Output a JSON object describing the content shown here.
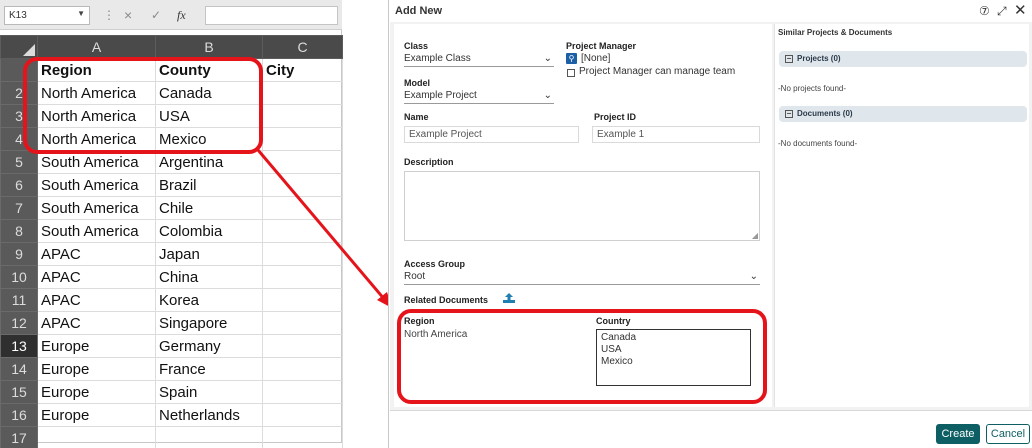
{
  "excel": {
    "name_box": "K13",
    "formula_icons": {
      "more": "⋮",
      "cancel": "×",
      "enter": "✓",
      "fx": "fx"
    },
    "columns": [
      "A",
      "B",
      "C"
    ],
    "header": {
      "row": "",
      "a": "Region",
      "b": "County",
      "c": "City"
    },
    "rows": [
      {
        "n": "2",
        "a": "North America",
        "b": "Canada",
        "c": ""
      },
      {
        "n": "3",
        "a": "North America",
        "b": "USA",
        "c": ""
      },
      {
        "n": "4",
        "a": "North America",
        "b": "Mexico",
        "c": ""
      },
      {
        "n": "5",
        "a": "South America",
        "b": "Argentina",
        "c": ""
      },
      {
        "n": "6",
        "a": "South America",
        "b": "Brazil",
        "c": ""
      },
      {
        "n": "7",
        "a": "South America",
        "b": "Chile",
        "c": ""
      },
      {
        "n": "8",
        "a": "South America",
        "b": "Colombia",
        "c": ""
      },
      {
        "n": "9",
        "a": "APAC",
        "b": "Japan",
        "c": ""
      },
      {
        "n": "10",
        "a": "APAC",
        "b": "China",
        "c": ""
      },
      {
        "n": "11",
        "a": "APAC",
        "b": "Korea",
        "c": ""
      },
      {
        "n": "12",
        "a": "APAC",
        "b": "Singapore",
        "c": ""
      },
      {
        "n": "13",
        "a": "Europe",
        "b": "Germany",
        "c": ""
      },
      {
        "n": "14",
        "a": "Europe",
        "b": "France",
        "c": ""
      },
      {
        "n": "15",
        "a": "Europe",
        "b": "Spain",
        "c": ""
      },
      {
        "n": "16",
        "a": "Europe",
        "b": "Netherlands",
        "c": ""
      },
      {
        "n": "17",
        "a": "",
        "b": "",
        "c": ""
      }
    ]
  },
  "dialog": {
    "title": "Add New",
    "controls": {
      "help": "⑦",
      "expand": "⤢",
      "close": "✕"
    },
    "class": {
      "label": "Class",
      "value": "Example Class"
    },
    "model": {
      "label": "Model",
      "value": "Example Project"
    },
    "project_manager": {
      "label": "Project Manager",
      "value": "[None]",
      "checkbox_label": "Project Manager can manage team"
    },
    "name": {
      "label": "Name",
      "value": "Example Project"
    },
    "project_id": {
      "label": "Project ID",
      "value": "Example 1"
    },
    "description": {
      "label": "Description"
    },
    "access_group": {
      "label": "Access Group",
      "value": "Root"
    },
    "related_documents": {
      "label": "Related Documents"
    },
    "region": {
      "label": "Region",
      "value": "North America"
    },
    "country": {
      "label": "Country",
      "options": [
        "Canada",
        "USA",
        "Mexico"
      ]
    },
    "side": {
      "header": "Similar Projects & Documents",
      "projects_header": "Projects (0)",
      "projects_empty": "-No projects found-",
      "documents_header": "Documents (0)",
      "documents_empty": "-No documents found-"
    },
    "buttons": {
      "create": "Create",
      "cancel": "Cancel"
    },
    "accent_color": "#0d5f63",
    "highlight_color": "#e5141b"
  }
}
